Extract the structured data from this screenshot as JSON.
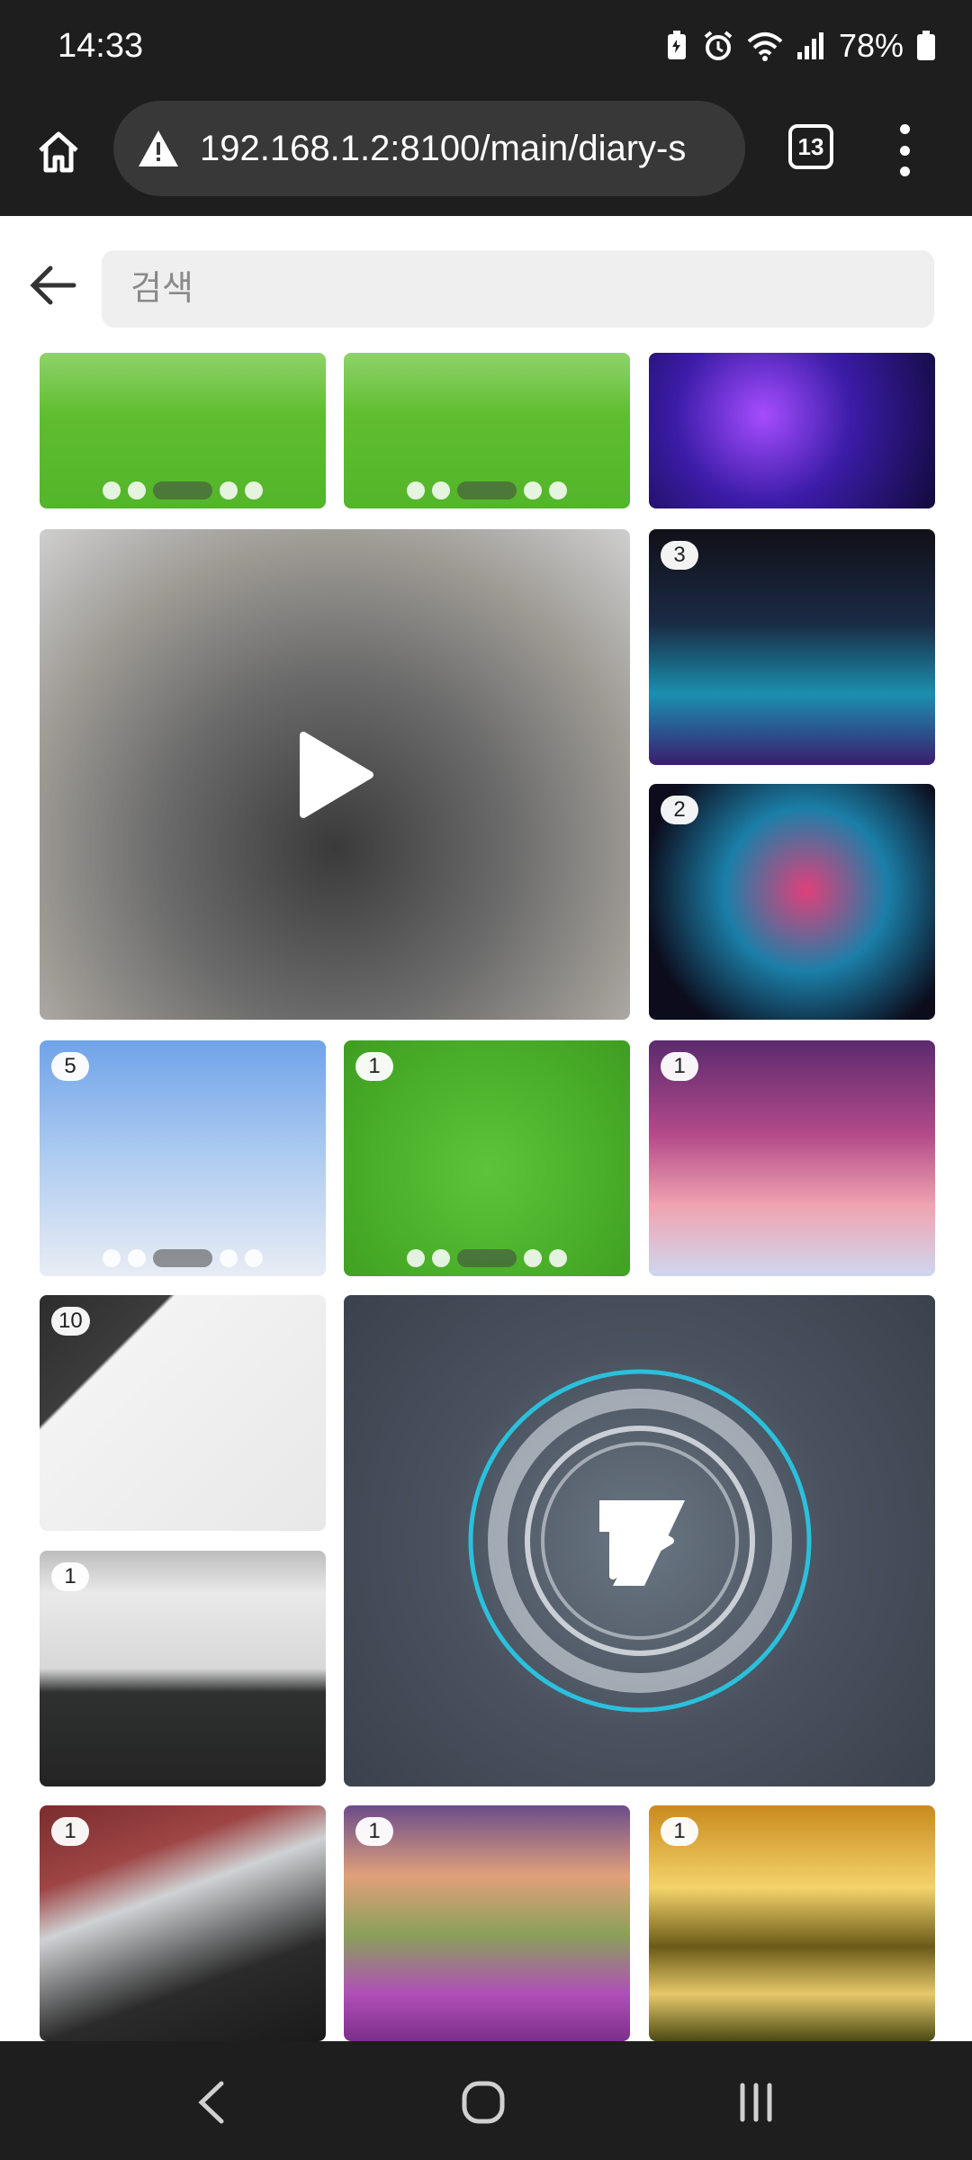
{
  "status_bar": {
    "time": "14:33",
    "battery": "78%",
    "icons": [
      "battery-saver-icon",
      "alarm-icon",
      "wifi-icon",
      "signal-icon",
      "battery-icon"
    ]
  },
  "browser": {
    "url": "192.168.1.2:8100/main/diary-s",
    "tab_count": "13",
    "security_icon": "warning-icon"
  },
  "header": {
    "search_placeholder": "검색",
    "back_icon": "arrow-left-icon"
  },
  "tiles": [
    {
      "name": "game-screenshot-1",
      "badge": ""
    },
    {
      "name": "game-screenshot-2",
      "badge": ""
    },
    {
      "name": "neon-character-art",
      "badge": ""
    },
    {
      "name": "cake-video",
      "badge": "",
      "is_video": true
    },
    {
      "name": "neon-character-collage",
      "badge": "3"
    },
    {
      "name": "neon-character-portrait",
      "badge": "2"
    },
    {
      "name": "avatar-sky-screenshot",
      "badge": "5"
    },
    {
      "name": "avatar-field-screenshot",
      "badge": "1"
    },
    {
      "name": "cartoon-poster",
      "badge": "1"
    },
    {
      "name": "notebook-photo",
      "badge": "10"
    },
    {
      "name": "logo-video",
      "badge": "",
      "is_video": true
    },
    {
      "name": "keyboard-photo",
      "badge": "1"
    },
    {
      "name": "laptop-photo",
      "badge": "1"
    },
    {
      "name": "flower-landscape",
      "badge": "1"
    },
    {
      "name": "sunset-tree-landscape",
      "badge": "1"
    }
  ],
  "nav": {
    "back_icon": "chevron-left-icon",
    "home_icon": "home-circle-icon",
    "recents_icon": "recent-apps-icon"
  }
}
